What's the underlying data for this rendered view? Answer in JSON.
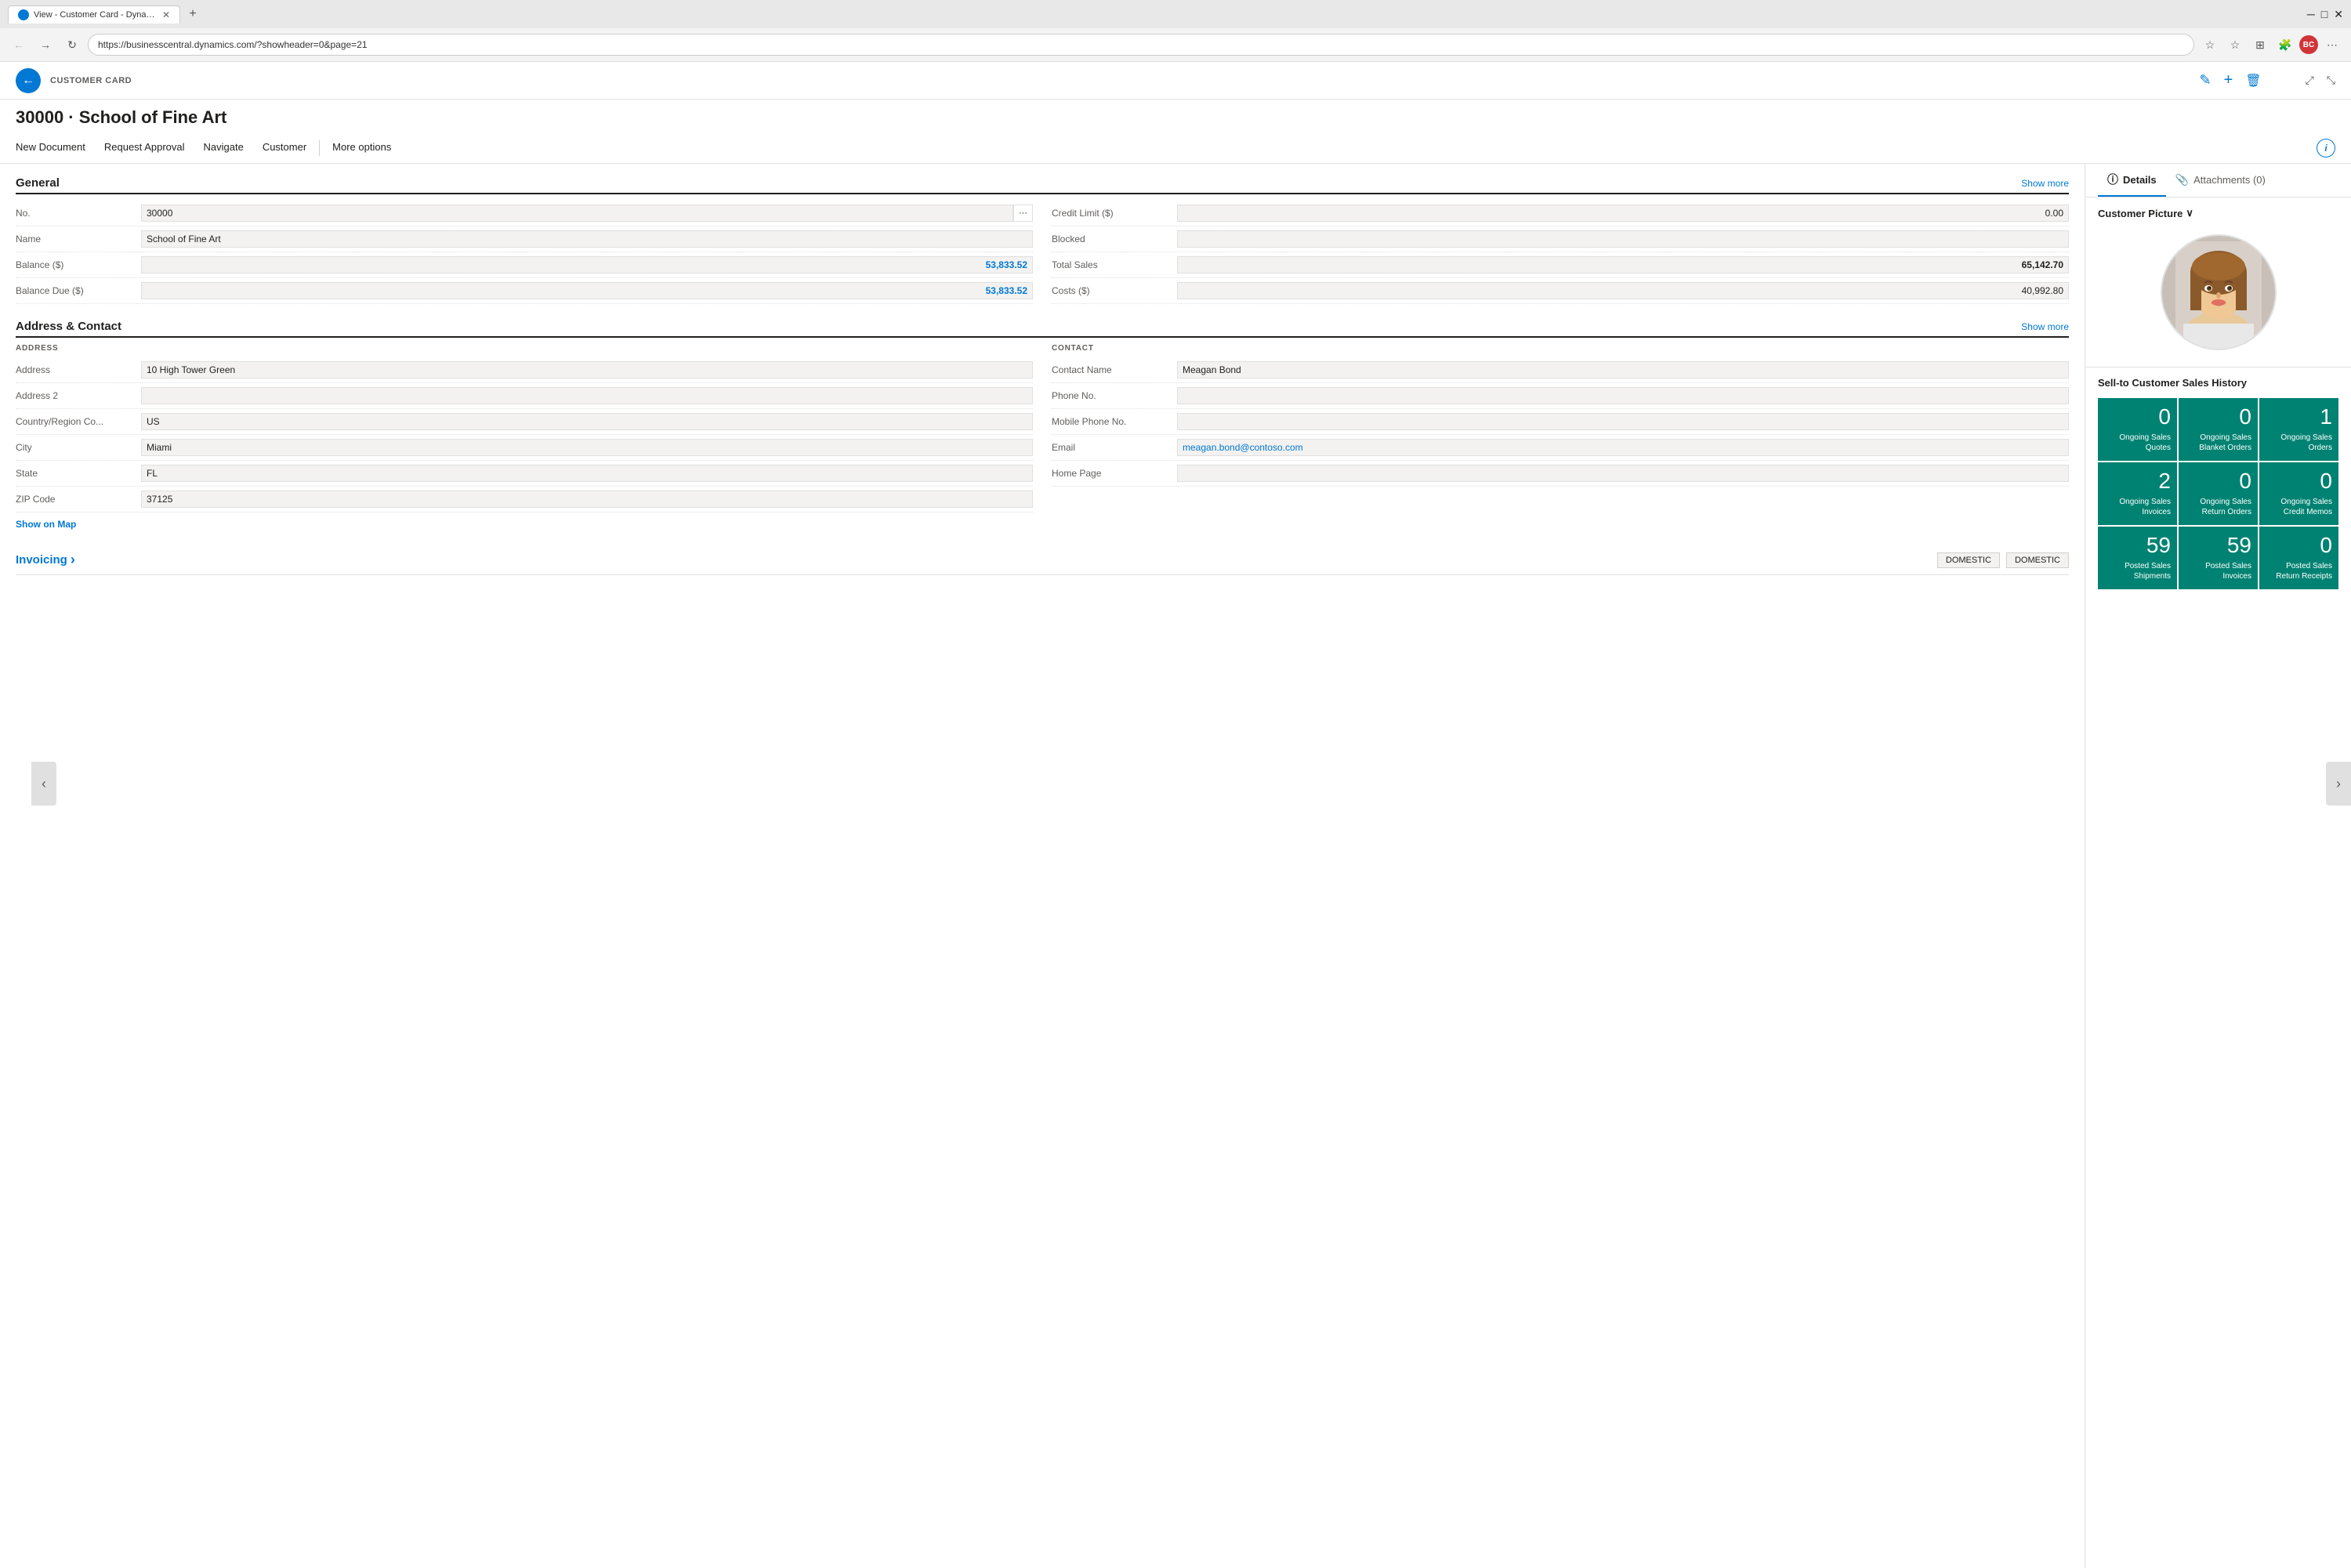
{
  "browser": {
    "tab_title": "View - Customer Card - Dynamics...",
    "url": "https://businesscentral.dynamics.com/?showheader=0&page=21",
    "new_tab_label": "+",
    "favicon_label": "BC"
  },
  "app": {
    "page_label": "CUSTOMER CARD",
    "back_btn_label": "←",
    "page_title": "30000 · School of Fine Art",
    "edit_icon": "✎",
    "add_icon": "+",
    "delete_icon": "🗑",
    "expand_icon": "⤢",
    "shrink_icon": "⤡",
    "info_icon": "i"
  },
  "action_bar": {
    "items": [
      {
        "label": "New Document"
      },
      {
        "label": "Request Approval"
      },
      {
        "label": "Navigate"
      },
      {
        "label": "Customer"
      },
      {
        "label": "More options"
      }
    ]
  },
  "general": {
    "section_title": "General",
    "show_more": "Show more",
    "fields_left": [
      {
        "label": "No.",
        "value": "30000",
        "has_btn": true
      },
      {
        "label": "Name",
        "value": "School of Fine Art"
      },
      {
        "label": "Balance ($)",
        "value": "53,833.52",
        "style": "teal"
      },
      {
        "label": "Balance Due ($)",
        "value": "53,833.52",
        "style": "teal"
      }
    ],
    "fields_right": [
      {
        "label": "Credit Limit ($)",
        "value": "0.00",
        "style": "right"
      },
      {
        "label": "Blocked",
        "value": ""
      },
      {
        "label": "Total Sales",
        "value": "65,142.70",
        "style": "bold"
      },
      {
        "label": "Costs ($)",
        "value": "40,992.80",
        "style": "right"
      }
    ]
  },
  "address_contact": {
    "section_title": "Address & Contact",
    "show_more": "Show more",
    "address_label": "ADDRESS",
    "contact_label": "CONTACT",
    "address_fields": [
      {
        "label": "Address",
        "value": "10 High Tower Green"
      },
      {
        "label": "Address 2",
        "value": ""
      },
      {
        "label": "Country/Region Co...",
        "value": "US"
      },
      {
        "label": "City",
        "value": "Miami"
      },
      {
        "label": "State",
        "value": "FL"
      },
      {
        "label": "ZIP Code",
        "value": "37125"
      }
    ],
    "contact_fields": [
      {
        "label": "Contact Name",
        "value": "Meagan Bond"
      },
      {
        "label": "Phone No.",
        "value": ""
      },
      {
        "label": "Mobile Phone No.",
        "value": ""
      },
      {
        "label": "Email",
        "value": "meagan.bond@contoso.com",
        "style": "link"
      },
      {
        "label": "Home Page",
        "value": ""
      }
    ],
    "show_on_map": "Show on Map"
  },
  "invoicing": {
    "title": "Invoicing",
    "chevron": "›",
    "badge1": "DOMESTIC",
    "badge2": "DOMESTIC"
  },
  "right_panel": {
    "tabs": [
      {
        "label": "Details",
        "icon": "ⓘ",
        "active": true
      },
      {
        "label": "Attachments (0)",
        "icon": "📎",
        "active": false
      }
    ],
    "customer_picture": {
      "label": "Customer Picture",
      "chevron": "∨"
    },
    "sales_history": {
      "title": "Sell-to Customer Sales History",
      "tiles": [
        {
          "number": "0",
          "label": "Ongoing Sales Quotes"
        },
        {
          "number": "0",
          "label": "Ongoing Sales Blanket Orders"
        },
        {
          "number": "1",
          "label": "Ongoing Sales Orders"
        },
        {
          "number": "2",
          "label": "Ongoing Sales Invoices"
        },
        {
          "number": "0",
          "label": "Ongoing Sales Return Orders"
        },
        {
          "number": "0",
          "label": "Ongoing Sales Credit Memos"
        },
        {
          "number": "59",
          "label": "Posted Sales Shipments"
        },
        {
          "number": "59",
          "label": "Posted Sales Invoices"
        },
        {
          "number": "0",
          "label": "Posted Sales Return Receipts"
        }
      ]
    }
  },
  "nav": {
    "left": "‹",
    "right": "›"
  }
}
